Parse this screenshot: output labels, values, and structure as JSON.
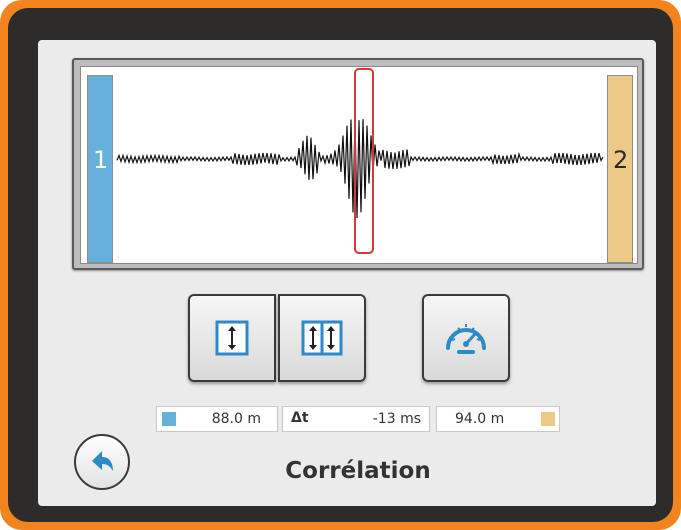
{
  "sensors": {
    "left": {
      "number": "1",
      "color": "#66b0dc"
    },
    "right": {
      "number": "2",
      "color": "#ecc986"
    }
  },
  "toolbar": {
    "buttons": [
      {
        "icon": "single-arrow-updown-icon"
      },
      {
        "icon": "double-arrow-updown-icon"
      },
      {
        "icon": "speedometer-icon"
      }
    ]
  },
  "readouts": {
    "left_distance": "88.0 m",
    "delta_label": "Δt",
    "delta_value": "-13 ms",
    "right_distance": "94.0 m"
  },
  "back": {
    "icon": "back-arrow-icon"
  },
  "page_title": "Corrélation",
  "colors": {
    "accent_blue": "#66b0dc",
    "accent_yellow": "#ecc986",
    "marker_red": "#d23a3a",
    "frame_orange": "#f2841f"
  }
}
